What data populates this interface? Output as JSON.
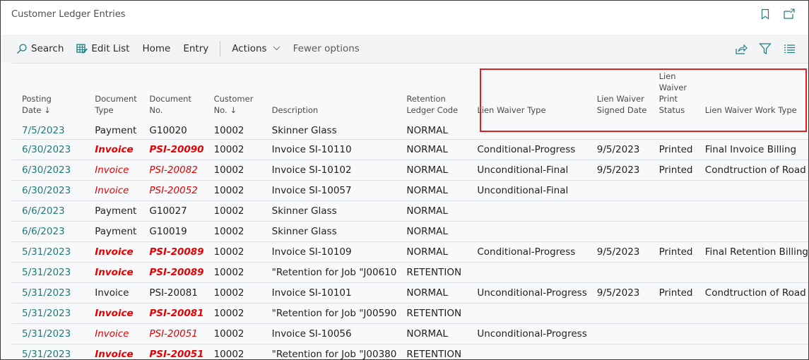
{
  "window": {
    "title": "Customer Ledger Entries",
    "title_icons": [
      {
        "name": "bookmark-icon"
      },
      {
        "name": "open-in-new-window-icon"
      }
    ]
  },
  "toolbar": {
    "items": [
      {
        "label": "Search",
        "icon": "search-icon"
      },
      {
        "label": "Edit List",
        "icon": "edit-list-icon"
      },
      {
        "label": "Home"
      },
      {
        "label": "Entry"
      },
      {
        "label": "Actions",
        "icon": "chevron-down-icon"
      },
      {
        "label": "Fewer options"
      }
    ],
    "right_icons": [
      {
        "name": "share-icon"
      },
      {
        "name": "filter-icon"
      },
      {
        "name": "list-view-icon"
      }
    ]
  },
  "colors": {
    "accent": "#1f7a7a",
    "negative": "#e60000",
    "highlight_border": "#e02020"
  },
  "table": {
    "columns": [
      {
        "key": "posting_date",
        "label": "Posting Date",
        "label_lines": [
          "Posting",
          "Date ↓"
        ]
      },
      {
        "key": "document_type",
        "label": "Document Type",
        "label_lines": [
          "Document",
          "Type"
        ]
      },
      {
        "key": "document_no",
        "label": "Document No.",
        "label_lines": [
          "Document",
          "No."
        ]
      },
      {
        "key": "customer_no",
        "label": "Customer No.",
        "label_lines": [
          "Customer",
          "No. ↓"
        ]
      },
      {
        "key": "description",
        "label": "Description",
        "label_lines": [
          "Description"
        ]
      },
      {
        "key": "retention_ledger_code",
        "label": "Retention Ledger Code",
        "label_lines": [
          "Retention",
          "Ledger Code"
        ]
      },
      {
        "key": "lien_waiver_type",
        "label": "Lien Waiver Type",
        "label_lines": [
          "Lien Waiver Type"
        ]
      },
      {
        "key": "lien_waiver_signed_date",
        "label": "Lien Waiver Signed Date",
        "label_lines": [
          "Lien Waiver",
          "Signed Date"
        ]
      },
      {
        "key": "lien_waiver_print_status",
        "label": "Lien Waiver Print Status",
        "label_lines": [
          "Lien",
          "Waiver",
          "Print",
          "Status"
        ]
      },
      {
        "key": "lien_waiver_work_type",
        "label": "Lien Waiver Work Type",
        "label_lines": [
          "Lien Waiver Work Type"
        ]
      }
    ],
    "rows": [
      {
        "style": "normal",
        "posting_date": "7/5/2023",
        "document_type": "Payment",
        "document_no": "G10020",
        "customer_no": "10002",
        "description": "Skinner Glass",
        "retention_ledger_code": "NORMAL",
        "lien_waiver_type": "",
        "lien_waiver_signed_date": "",
        "lien_waiver_print_status": "",
        "lien_waiver_work_type": ""
      },
      {
        "style": "bold-red",
        "posting_date": "6/30/2023",
        "document_type": "Invoice",
        "document_no": "PSI-20090",
        "customer_no": "10002",
        "description": "Invoice SI-10110",
        "retention_ledger_code": "NORMAL",
        "lien_waiver_type": "Conditional-Progress",
        "lien_waiver_signed_date": "9/5/2023",
        "lien_waiver_print_status": "Printed",
        "lien_waiver_work_type": "Final Invoice Billing"
      },
      {
        "style": "italic-red",
        "posting_date": "6/30/2023",
        "document_type": "Invoice",
        "document_no": "PSI-20082",
        "customer_no": "10002",
        "description": "Invoice SI-10102",
        "retention_ledger_code": "NORMAL",
        "lien_waiver_type": "Unconditional-Final",
        "lien_waiver_signed_date": "9/5/2023",
        "lien_waiver_print_status": "Printed",
        "lien_waiver_work_type": "Condtruction of Road"
      },
      {
        "style": "italic-red",
        "posting_date": "6/30/2023",
        "document_type": "Invoice",
        "document_no": "PSI-20052",
        "customer_no": "10002",
        "description": "Invoice SI-10057",
        "retention_ledger_code": "NORMAL",
        "lien_waiver_type": "Unconditional-Final",
        "lien_waiver_signed_date": "",
        "lien_waiver_print_status": "",
        "lien_waiver_work_type": ""
      },
      {
        "style": "normal",
        "posting_date": "6/6/2023",
        "document_type": "Payment",
        "document_no": "G10027",
        "customer_no": "10002",
        "description": "Skinner Glass",
        "retention_ledger_code": "NORMAL",
        "lien_waiver_type": "",
        "lien_waiver_signed_date": "",
        "lien_waiver_print_status": "",
        "lien_waiver_work_type": ""
      },
      {
        "style": "normal",
        "posting_date": "6/6/2023",
        "document_type": "Payment",
        "document_no": "G10019",
        "customer_no": "10002",
        "description": "Skinner Glass",
        "retention_ledger_code": "NORMAL",
        "lien_waiver_type": "",
        "lien_waiver_signed_date": "",
        "lien_waiver_print_status": "",
        "lien_waiver_work_type": ""
      },
      {
        "style": "bold-red",
        "posting_date": "5/31/2023",
        "document_type": "Invoice",
        "document_no": "PSI-20089",
        "customer_no": "10002",
        "description": "Invoice SI-10109",
        "retention_ledger_code": "NORMAL",
        "lien_waiver_type": "Conditional-Progress",
        "lien_waiver_signed_date": "9/5/2023",
        "lien_waiver_print_status": "Printed",
        "lien_waiver_work_type": "Final Retention Billing"
      },
      {
        "style": "bold-red",
        "posting_date": "5/31/2023",
        "document_type": "Invoice",
        "document_no": "PSI-20089",
        "customer_no": "10002",
        "description": "\"Retention for Job \"J00610",
        "retention_ledger_code": "RETENTION",
        "lien_waiver_type": "",
        "lien_waiver_signed_date": "",
        "lien_waiver_print_status": "",
        "lien_waiver_work_type": ""
      },
      {
        "style": "normal",
        "posting_date": "5/31/2023",
        "document_type": "Invoice",
        "document_no": "PSI-20081",
        "customer_no": "10002",
        "description": "Invoice SI-10101",
        "retention_ledger_code": "NORMAL",
        "lien_waiver_type": "Unconditional-Progress",
        "lien_waiver_signed_date": "9/5/2023",
        "lien_waiver_print_status": "Printed",
        "lien_waiver_work_type": "Condtruction of Road"
      },
      {
        "style": "bold-red",
        "posting_date": "5/31/2023",
        "document_type": "Invoice",
        "document_no": "PSI-20081",
        "customer_no": "10002",
        "description": "\"Retention for Job \"J00590",
        "retention_ledger_code": "RETENTION",
        "lien_waiver_type": "",
        "lien_waiver_signed_date": "",
        "lien_waiver_print_status": "",
        "lien_waiver_work_type": ""
      },
      {
        "style": "italic-red",
        "posting_date": "5/31/2023",
        "document_type": "Invoice",
        "document_no": "PSI-20051",
        "customer_no": "10002",
        "description": "Invoice SI-10056",
        "retention_ledger_code": "NORMAL",
        "lien_waiver_type": "Unconditional-Progress",
        "lien_waiver_signed_date": "",
        "lien_waiver_print_status": "",
        "lien_waiver_work_type": ""
      },
      {
        "style": "bold-red",
        "posting_date": "5/31/2023",
        "document_type": "Invoice",
        "document_no": "PSI-20051",
        "customer_no": "10002",
        "description": "\"Retention for Job \"J00380",
        "retention_ledger_code": "RETENTION",
        "lien_waiver_type": "",
        "lien_waiver_signed_date": "",
        "lien_waiver_print_status": "",
        "lien_waiver_work_type": ""
      }
    ]
  }
}
